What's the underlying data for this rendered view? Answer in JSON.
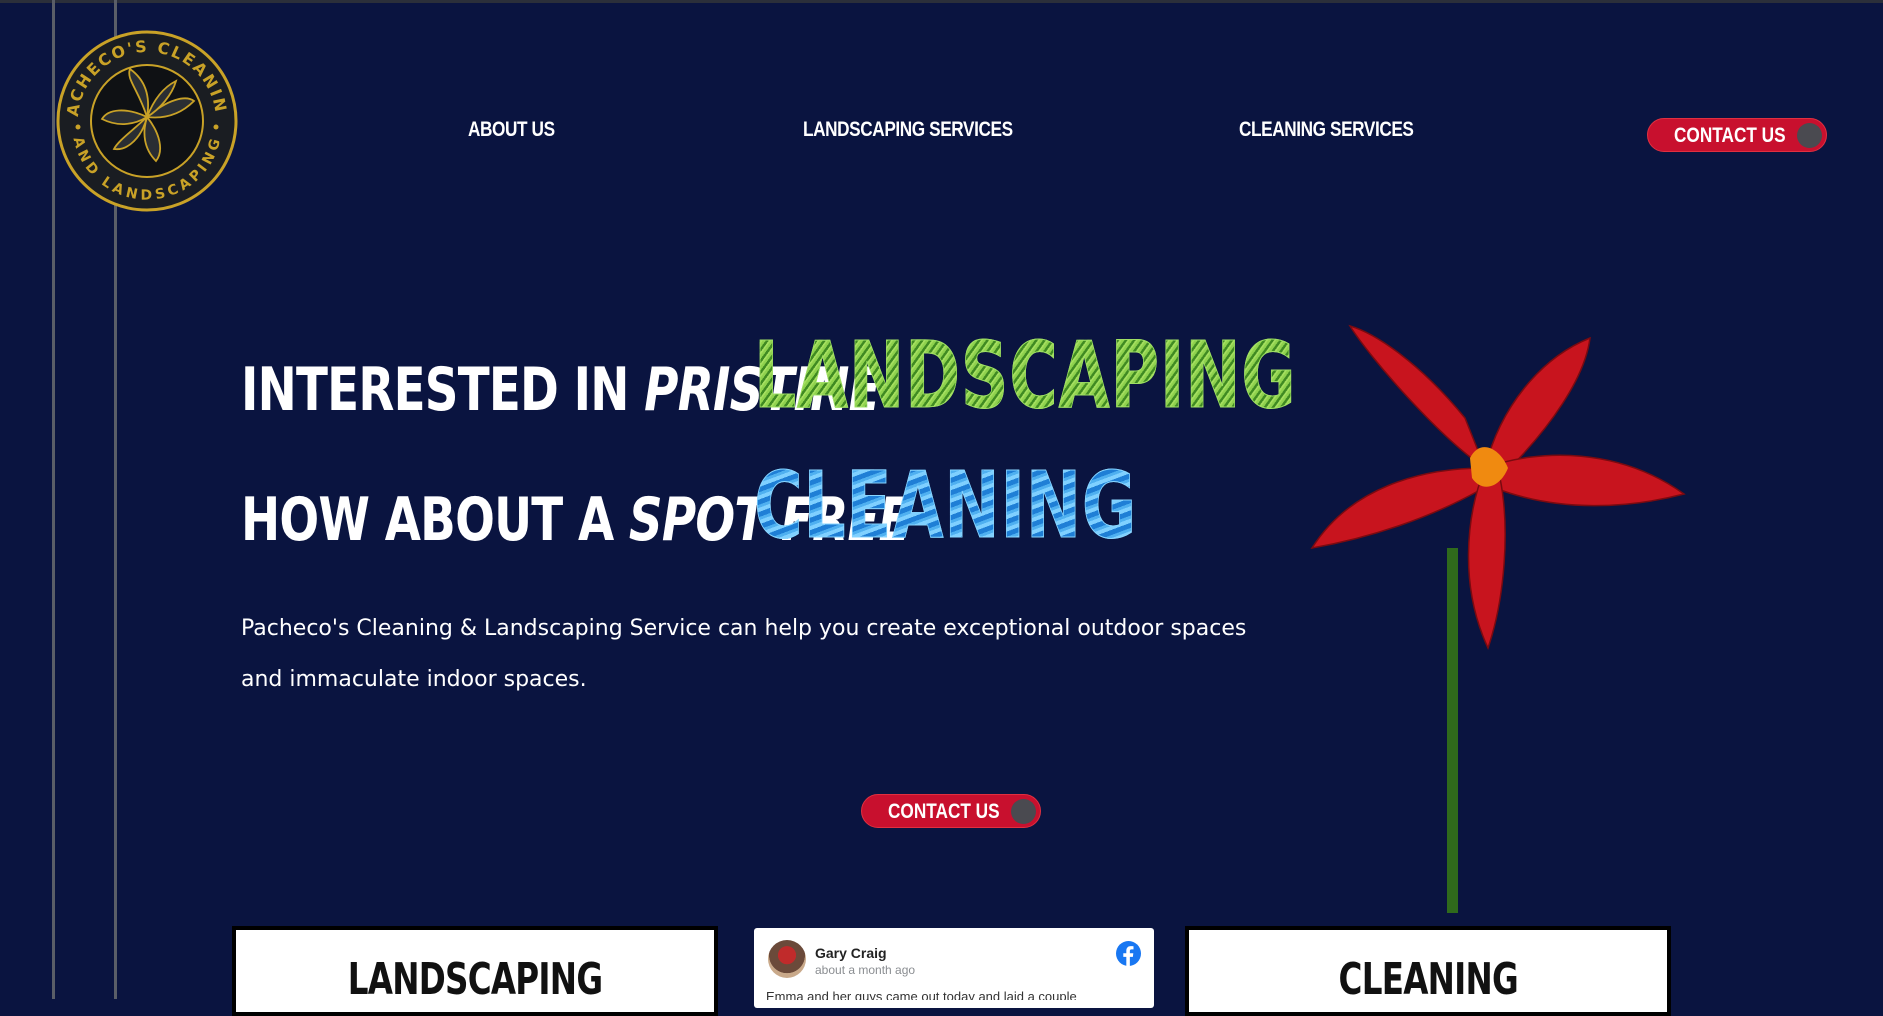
{
  "nav": {
    "logo_text_top": "PACHECO'S CLEANING",
    "logo_text_bottom": "AND LANDSCAPING",
    "links": [
      {
        "label": "ABOUT US"
      },
      {
        "label": "LANDSCAPING SERVICES"
      },
      {
        "label": "CLEANING SERVICES"
      }
    ],
    "contact_label": "CONTACT US"
  },
  "hero": {
    "line1_prefix": "INTERESTED IN ",
    "line1_emph": "PRISTINE",
    "line1_word": "LANDSCAPING",
    "line2_prefix": "HOW ABOUT A ",
    "line2_emph": "SPOT FREE",
    "line2_word": "CLEANING",
    "description": "Pacheco's Cleaning & Landscaping Service can help you create exceptional outdoor spaces and immaculate indoor spaces.",
    "cta_label": "CONTACT US"
  },
  "cards": {
    "landscaping_title": "LANDSCAPING",
    "cleaning_title": "CLEANING"
  },
  "review": {
    "name": "Gary Craig",
    "time": "about a month ago",
    "text": "Emma and her guys came out today and laid a couple"
  },
  "colors": {
    "background": "#0a1440",
    "accent_red": "#c8102e",
    "landscaping_green": "#6fbf3c",
    "cleaning_blue": "#3a9be8",
    "logo_gold": "#c9a227"
  },
  "icons": [
    "logo-emblem",
    "flower-image",
    "facebook-icon",
    "toggle-knob"
  ]
}
